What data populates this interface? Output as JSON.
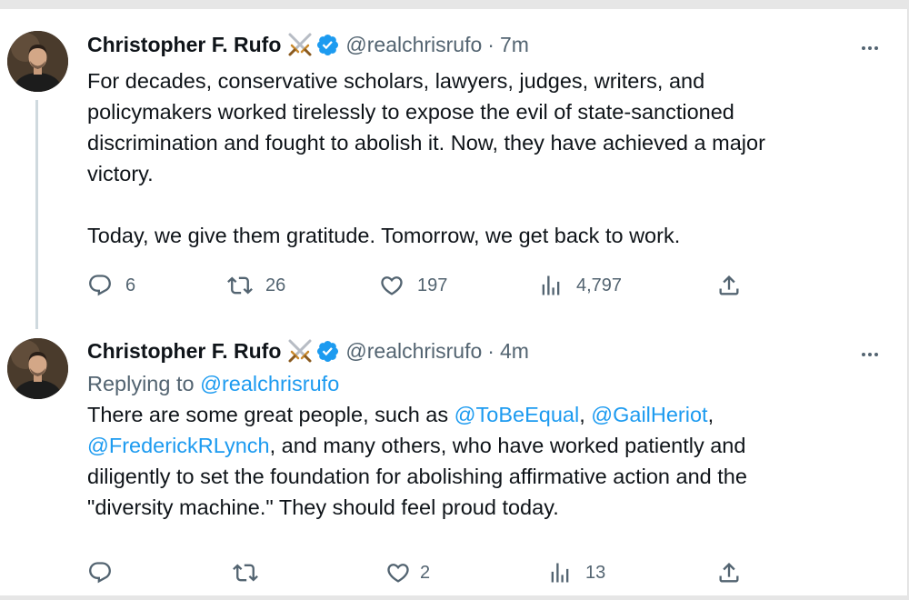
{
  "tweets": [
    {
      "author_name": "Christopher F. Rufo",
      "name_emoji": "crossed-swords",
      "handle": "@realchrisrufo",
      "separator": "·",
      "time": "7m",
      "text_lines": [
        "For decades, conservative scholars, lawyers, judges, writers, and",
        "policymakers worked tirelessly to expose the evil of state-sanctioned",
        "discrimination and fought to abolish it. Now, they have achieved a major",
        "victory.",
        "",
        "Today, we give them gratitude. Tomorrow, we get back to work."
      ],
      "replies": "6",
      "retweets": "26",
      "likes": "197",
      "views": "4,797"
    },
    {
      "author_name": "Christopher F. Rufo",
      "name_emoji": "crossed-swords",
      "handle": "@realchrisrufo",
      "separator": "·",
      "time": "4m",
      "replying_prefix": "Replying to ",
      "replying_to": "@realchrisrufo",
      "line1_text": "There are some great people, such as ",
      "mention1": "@ToBeEqual",
      "sep1": ", ",
      "mention2": "@GailHeriot",
      "sep2": ",",
      "mention3": "@FrederickRLynch",
      "line2_text": ", and many others, who have worked patiently and",
      "line3_text": "diligently to set the foundation for abolishing affirmative action and the",
      "line4_text": "\"diversity machine.\" They should feel proud today.",
      "replies": "",
      "retweets": "",
      "likes": "2",
      "views": "13"
    }
  ],
  "colors": {
    "text": "#0f1419",
    "muted": "#536471",
    "link": "#1d9bf0",
    "verified": "#1d9bf0",
    "thread_line": "#cfd9de"
  }
}
